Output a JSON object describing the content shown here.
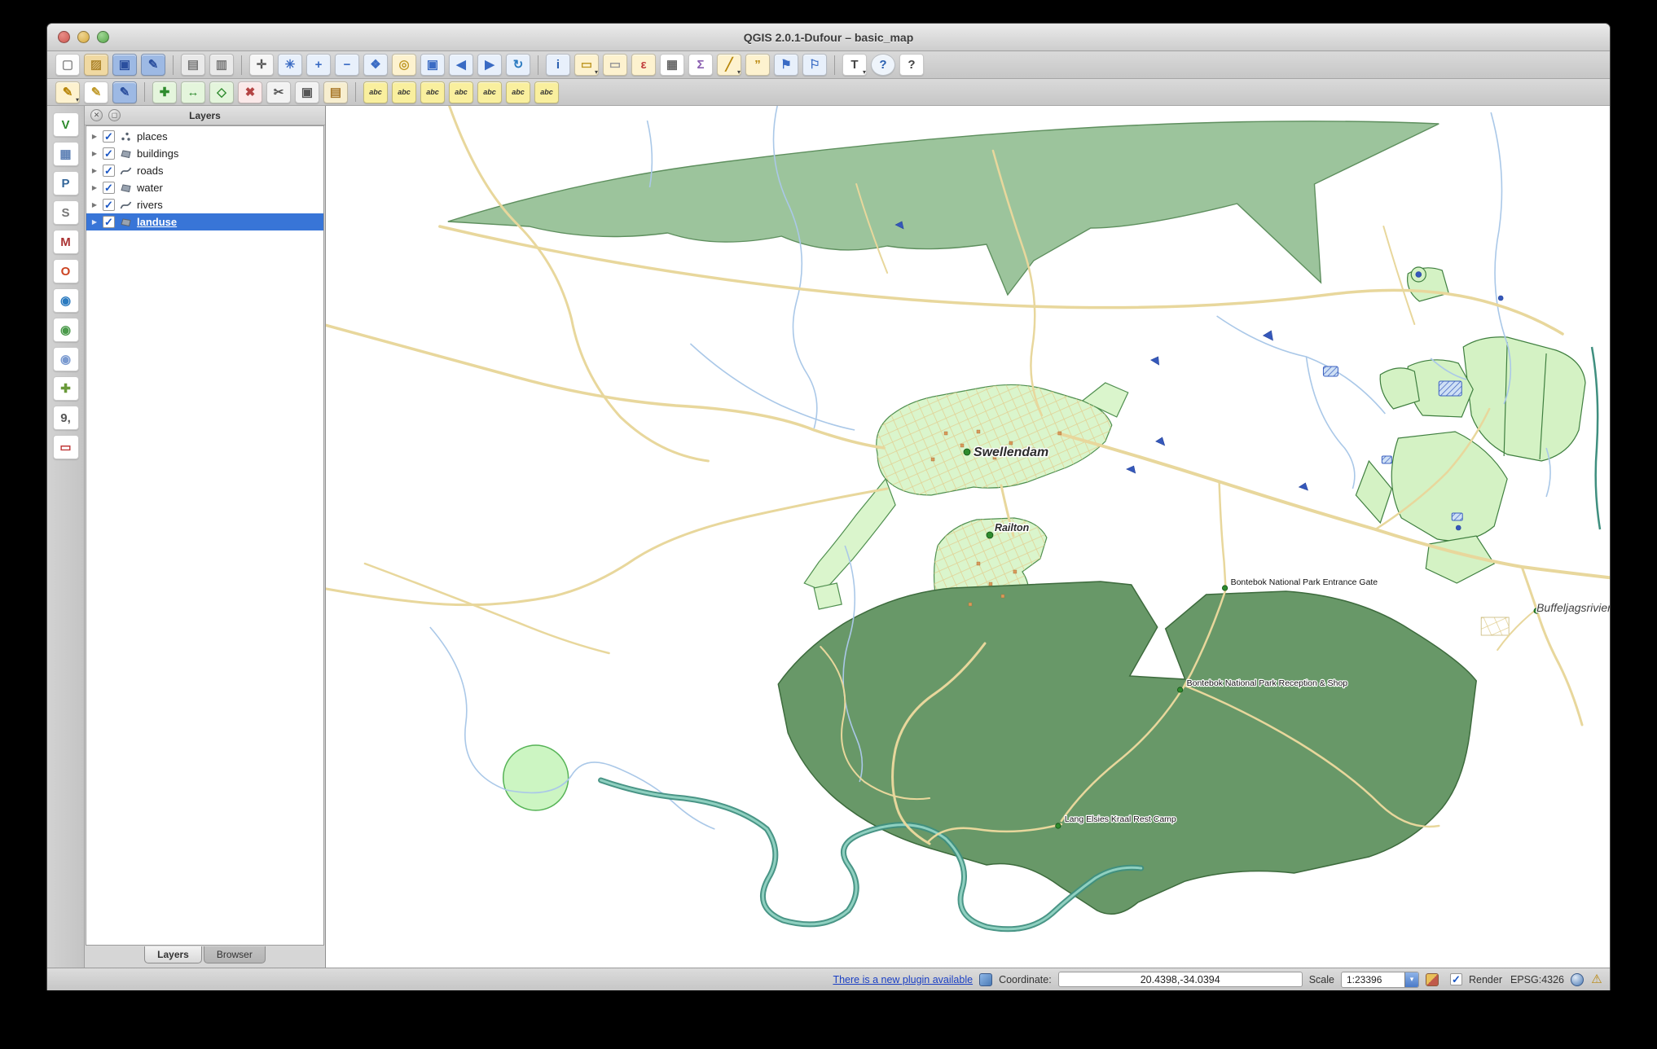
{
  "window": {
    "title": "QGIS 2.0.1-Dufour – basic_map"
  },
  "glyphs": {
    "dropdown": "▾",
    "expander": "▶",
    "close": "✕",
    "float": "◻",
    "warning": "⚠",
    "check": "✓"
  },
  "colors": {
    "selection": "#3875d7",
    "forest": "#9cc49c",
    "park": "#689868",
    "urban": "#daf5cc",
    "cluster": "#d4f2c4",
    "road": "#e8d79c",
    "river": "#aac8e8",
    "river_major": "#3f8f7f",
    "water": "#3558bb"
  },
  "toolbars": {
    "row1": [
      {
        "name": "new-project",
        "bg": "#fdfdfd",
        "glyph": "▢",
        "fg": "#888"
      },
      {
        "name": "open-project",
        "bg": "#f0d9a2",
        "glyph": "▨",
        "fg": "#b08830"
      },
      {
        "name": "save-project",
        "bg": "#9db9e4",
        "glyph": "▣",
        "fg": "#2b4f9e"
      },
      {
        "name": "save-project-as",
        "bg": "#9db9e4",
        "glyph": "✎",
        "fg": "#2b4f9e"
      },
      {
        "sep": true
      },
      {
        "name": "new-print-composer",
        "bg": "#e9e9e9",
        "glyph": "▤",
        "fg": "#777"
      },
      {
        "name": "composer-manager",
        "bg": "#e9e9e9",
        "glyph": "▥",
        "fg": "#777"
      },
      {
        "sep": true
      },
      {
        "name": "pan-map",
        "bg": "#f6f6f6",
        "glyph": "✛",
        "fg": "#555"
      },
      {
        "name": "touch-zoom",
        "bg": "#e8f0fb",
        "glyph": "✳",
        "fg": "#3a6bc4"
      },
      {
        "name": "zoom-in",
        "bg": "#e8f0fb",
        "glyph": "+",
        "fg": "#3a6bc4"
      },
      {
        "name": "zoom-out",
        "bg": "#e8f0fb",
        "glyph": "−",
        "fg": "#3a6bc4"
      },
      {
        "name": "zoom-full-extent",
        "bg": "#e8f0fb",
        "glyph": "❖",
        "fg": "#3a6bc4"
      },
      {
        "name": "zoom-to-selection",
        "bg": "#fdf2cf",
        "glyph": "◎",
        "fg": "#c09a2a"
      },
      {
        "name": "zoom-to-layer",
        "bg": "#e8f0fb",
        "glyph": "▣",
        "fg": "#3a6bc4"
      },
      {
        "name": "zoom-last",
        "bg": "#e8f0fb",
        "glyph": "◀",
        "fg": "#3a6bc4"
      },
      {
        "name": "zoom-next",
        "bg": "#e8f0fb",
        "glyph": "▶",
        "fg": "#3a6bc4"
      },
      {
        "name": "refresh-map",
        "bg": "#e8f0fb",
        "glyph": "↻",
        "fg": "#2a7ac0"
      },
      {
        "sep": true
      },
      {
        "name": "identify-features",
        "bg": "#e8f0fb",
        "glyph": "i",
        "fg": "#2a5fb0"
      },
      {
        "name": "select-features",
        "bg": "#fdf2cf",
        "glyph": "▭",
        "fg": "#c09a2a",
        "dd": true
      },
      {
        "name": "deselect-features",
        "bg": "#fdf2cf",
        "glyph": "▭",
        "fg": "#999"
      },
      {
        "name": "select-by-expression",
        "bg": "#fdf2cf",
        "glyph": "ε",
        "fg": "#c03a3a"
      },
      {
        "name": "open-attribute-table",
        "bg": "#ffffff",
        "glyph": "▦",
        "fg": "#666"
      },
      {
        "name": "field-calculator",
        "bg": "#ffffff",
        "glyph": "Σ",
        "fg": "#8a5fb0"
      },
      {
        "name": "measure-line",
        "bg": "#fdf2cf",
        "glyph": "╱",
        "fg": "#b8860b",
        "dd": true
      },
      {
        "name": "map-tips",
        "bg": "#fdf2cf",
        "glyph": "”",
        "fg": "#b8860b"
      },
      {
        "name": "new-bookmark",
        "bg": "#e8f0fb",
        "glyph": "⚑",
        "fg": "#3a6bc4"
      },
      {
        "name": "show-bookmarks",
        "bg": "#e8f0fb",
        "glyph": "⚐",
        "fg": "#3a6bc4"
      },
      {
        "sep": true
      },
      {
        "name": "text-annotation",
        "bg": "#ffffff",
        "glyph": "T",
        "fg": "#444",
        "dd": true
      },
      {
        "name": "help-contents",
        "bg": "#eef4fb",
        "glyph": "?",
        "fg": "#2a5fb0",
        "round": true
      },
      {
        "name": "whats-this",
        "bg": "#ffffff",
        "glyph": "?",
        "fg": "#444"
      }
    ],
    "row2": [
      {
        "name": "current-edits",
        "bg": "#fdf2cf",
        "glyph": "✎",
        "fg": "#b8860b",
        "dd": true
      },
      {
        "name": "toggle-editing",
        "bg": "#ffffff",
        "glyph": "✎",
        "fg": "#c09a2a"
      },
      {
        "name": "save-layer-edits",
        "bg": "#9db9e4",
        "glyph": "✎",
        "fg": "#2b4f9e"
      },
      {
        "sep": true
      },
      {
        "name": "add-feature",
        "bg": "#e4f5dc",
        "glyph": "✚",
        "fg": "#2e8b2e"
      },
      {
        "name": "move-feature",
        "bg": "#e4f5dc",
        "glyph": "↔",
        "fg": "#2e8b2e"
      },
      {
        "name": "node-tool",
        "bg": "#e4f5dc",
        "glyph": "◇",
        "fg": "#2e8b2e"
      },
      {
        "name": "delete-selected",
        "bg": "#fbe9e9",
        "glyph": "✖",
        "fg": "#b44444"
      },
      {
        "name": "cut-features",
        "bg": "#f2f2f2",
        "glyph": "✂",
        "fg": "#555"
      },
      {
        "name": "copy-features",
        "bg": "#f2f2f2",
        "glyph": "▣",
        "fg": "#555"
      },
      {
        "name": "paste-features",
        "bg": "#f7eecf",
        "glyph": "▤",
        "fg": "#a8782a"
      },
      {
        "sep": true
      },
      {
        "name": "layer-labeling-options",
        "bg": "#f9ef9e",
        "glyph": "abc",
        "fg": "#333"
      },
      {
        "name": "highlight-pinned-labels",
        "bg": "#f9ef9e",
        "glyph": "abc",
        "fg": "#333"
      },
      {
        "name": "pin-unpin-labels",
        "bg": "#f9ef9e",
        "glyph": "abc",
        "fg": "#333"
      },
      {
        "name": "show-hide-labels",
        "bg": "#f9ef9e",
        "glyph": "abc",
        "fg": "#333"
      },
      {
        "name": "move-label",
        "bg": "#f9ef9e",
        "glyph": "abc",
        "fg": "#333"
      },
      {
        "name": "rotate-label",
        "bg": "#f9ef9e",
        "glyph": "abc",
        "fg": "#333"
      },
      {
        "name": "change-label-properties",
        "bg": "#f9ef9e",
        "glyph": "abc",
        "fg": "#333"
      }
    ],
    "left": [
      {
        "name": "add-vector-layer",
        "bg": "#ffffff",
        "glyph": "V",
        "fg": "#2e8b2e"
      },
      {
        "name": "add-raster-layer",
        "bg": "#ffffff",
        "glyph": "▦",
        "fg": "#5b7fb4"
      },
      {
        "name": "add-postgis-layer",
        "bg": "#ffffff",
        "glyph": "P",
        "fg": "#336699"
      },
      {
        "name": "add-spatialite-layer",
        "bg": "#ffffff",
        "glyph": "S",
        "fg": "#777777"
      },
      {
        "name": "add-mssql-layer",
        "bg": "#ffffff",
        "glyph": "M",
        "fg": "#aa3333"
      },
      {
        "name": "add-oracle-layer",
        "bg": "#ffffff",
        "glyph": "O",
        "fg": "#cc4422"
      },
      {
        "name": "add-wms-layer",
        "bg": "#ffffff",
        "glyph": "◉",
        "fg": "#2a7ac0"
      },
      {
        "name": "add-wcs-layer",
        "bg": "#ffffff",
        "glyph": "◉",
        "fg": "#4a9a4a"
      },
      {
        "name": "add-wfs-layer",
        "bg": "#ffffff",
        "glyph": "◉",
        "fg": "#7a9ad0"
      },
      {
        "name": "new-shapefile-layer",
        "bg": "#ffffff",
        "glyph": "✚",
        "fg": "#6a9a3a"
      },
      {
        "name": "add-delimited-text-layer",
        "bg": "#ffffff",
        "glyph": "9,",
        "fg": "#555"
      },
      {
        "name": "remove-layer",
        "bg": "#ffffff",
        "glyph": "▭",
        "fg": "#c03a3a"
      }
    ]
  },
  "layers_panel": {
    "title": "Layers",
    "layers": [
      {
        "label": "places",
        "type": "point",
        "checked": true,
        "selected": false
      },
      {
        "label": "buildings",
        "type": "polygon",
        "checked": true,
        "selected": false
      },
      {
        "label": "roads",
        "type": "line",
        "checked": true,
        "selected": false
      },
      {
        "label": "water",
        "type": "polygon",
        "checked": true,
        "selected": false
      },
      {
        "label": "rivers",
        "type": "line",
        "checked": true,
        "selected": false
      },
      {
        "label": "landuse",
        "type": "polygon",
        "checked": true,
        "selected": true
      }
    ],
    "tabs": [
      {
        "label": "Layers",
        "active": true
      },
      {
        "label": "Browser",
        "active": false
      }
    ]
  },
  "map": {
    "labels": [
      {
        "id": "swellendam",
        "text": "Swellendam"
      },
      {
        "id": "railton",
        "text": "Railton"
      },
      {
        "id": "entrance",
        "text": "Bontebok National Park Entrance Gate"
      },
      {
        "id": "reception",
        "text": "Bontebok National Park Reception & Shop"
      },
      {
        "id": "restcamp",
        "text": "Lang Elsies Kraal Rest Camp"
      },
      {
        "id": "buffeljagsrivier",
        "text": "Buffeljagsrivier"
      }
    ]
  },
  "status_bar": {
    "plugin_link": "There is a new plugin available",
    "coordinate_label": "Coordinate:",
    "coordinate_value": "20.4398,-34.0394",
    "scale_label": "Scale",
    "scale_value": "1:23396",
    "render_label": "Render",
    "epsg": "EPSG:4326"
  }
}
